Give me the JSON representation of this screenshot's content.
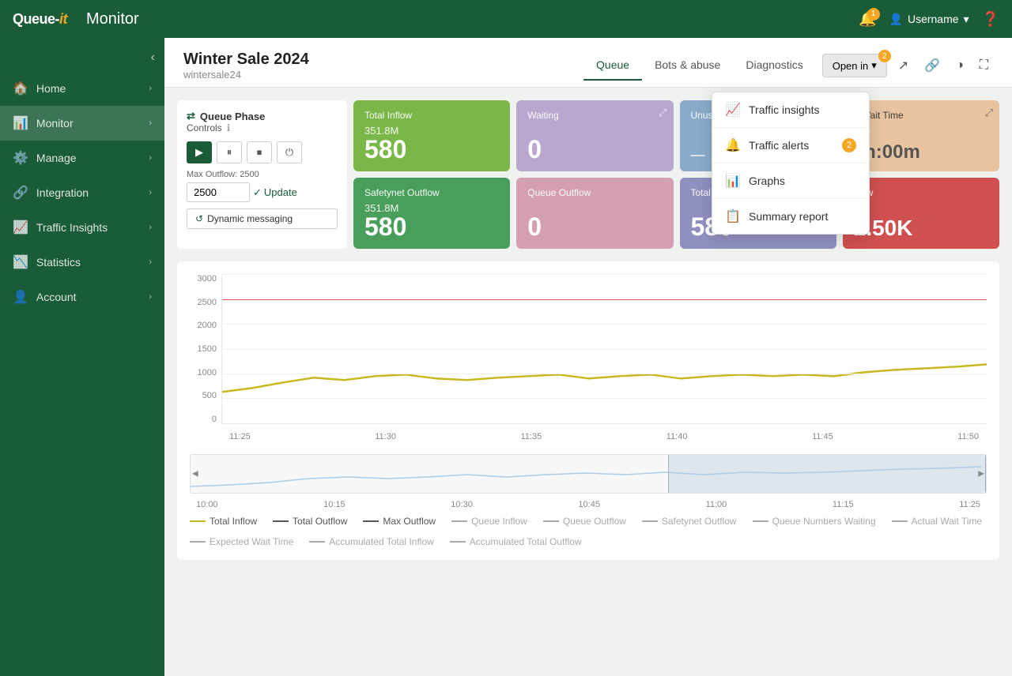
{
  "app": {
    "logo": "Queue-it",
    "page_title": "Monitor"
  },
  "topnav": {
    "bell_count": "1",
    "username": "Username",
    "help_icon": "?"
  },
  "sidebar": {
    "items": [
      {
        "id": "home",
        "label": "Home",
        "icon": "🏠",
        "has_chevron": true
      },
      {
        "id": "monitor",
        "label": "Monitor",
        "icon": "📊",
        "has_chevron": true,
        "active": true
      },
      {
        "id": "manage",
        "label": "Manage",
        "icon": "⚙️",
        "has_chevron": true
      },
      {
        "id": "integration",
        "label": "Integration",
        "icon": "🔗",
        "has_chevron": true
      },
      {
        "id": "traffic-insights",
        "label": "Traffic Insights",
        "icon": "📈",
        "has_chevron": true
      },
      {
        "id": "statistics",
        "label": "Statistics",
        "icon": "📉",
        "has_chevron": true
      },
      {
        "id": "account",
        "label": "Account",
        "icon": "👤",
        "has_chevron": true
      }
    ]
  },
  "page": {
    "queue_name": "Winter Sale 2024",
    "queue_id": "wintersale24",
    "tabs": [
      {
        "id": "queue",
        "label": "Queue",
        "active": true
      },
      {
        "id": "bots-abuse",
        "label": "Bots & abuse",
        "active": false
      },
      {
        "id": "diagnostics",
        "label": "Diagnostics",
        "active": false
      }
    ],
    "open_in_label": "Open in",
    "open_in_badge": "2"
  },
  "controls": {
    "section_title": "Queue Phase",
    "controls_label": "Controls",
    "max_outflow_label": "Max Outflow: 2500",
    "max_outflow_value": "2500",
    "update_label": "Update",
    "dynamic_messaging_label": "Dynamic messaging"
  },
  "metrics": {
    "total_inflow": {
      "label": "Total Inflow",
      "sub": "351.8M",
      "value": "580"
    },
    "waiting": {
      "label": "Waiting",
      "value": "0"
    },
    "unused": {
      "label": "Unused",
      "value": ""
    },
    "wait_time": {
      "label": "d Wait Time",
      "value": "0h:00m"
    },
    "safetynet_outflow": {
      "label": "Safetynet Outflow",
      "sub": "351.8M",
      "value": "580"
    },
    "queue_outflow": {
      "label": "Queue Outflow",
      "value": "0"
    },
    "total_outflow": {
      "label": "Total Ou",
      "value": "580"
    },
    "total_outflow_right": {
      "label": "tflow",
      "value": "2.50K"
    }
  },
  "chart": {
    "y_labels": [
      "3000",
      "2500",
      "2000",
      "1500",
      "1000",
      "500",
      "0"
    ],
    "x_labels": [
      "11:25",
      "11:30",
      "11:35",
      "11:40",
      "11:45",
      "11:50"
    ],
    "nav_x_labels": [
      "10:00",
      "10:15",
      "10:30",
      "10:45",
      "11:00",
      "11:15",
      "11:25"
    ],
    "red_line_value": 2500,
    "max_value": 3000
  },
  "legend": {
    "items": [
      {
        "color": "#c8b820",
        "label": "Total Inflow"
      },
      {
        "color": "#555",
        "label": "Total Outflow"
      },
      {
        "color": "#555",
        "label": "Max Outflow"
      },
      {
        "color": "#aaa",
        "label": "Queue Inflow"
      },
      {
        "color": "#aaa",
        "label": "Queue Outflow"
      },
      {
        "color": "#aaa",
        "label": "Safetynet Outflow"
      },
      {
        "color": "#aaa",
        "label": "Queue Numbers Waiting"
      },
      {
        "color": "#aaa",
        "label": "Actual Wait Time"
      },
      {
        "color": "#aaa",
        "label": "Expected Wait Time"
      },
      {
        "color": "#aaa",
        "label": "Accumulated Total Inflow"
      },
      {
        "color": "#aaa",
        "label": "Accumulated Total Outflow"
      }
    ]
  },
  "dropdown": {
    "items": [
      {
        "id": "traffic-insights",
        "icon": "📈",
        "label": "Traffic insights",
        "badge": null
      },
      {
        "id": "traffic-alerts",
        "icon": "🔔",
        "label": "Traffic alerts",
        "badge": "2"
      },
      {
        "id": "graphs",
        "icon": "📊",
        "label": "Graphs",
        "badge": null
      },
      {
        "id": "summary-report",
        "icon": "📋",
        "label": "Summary report",
        "badge": null
      }
    ]
  }
}
